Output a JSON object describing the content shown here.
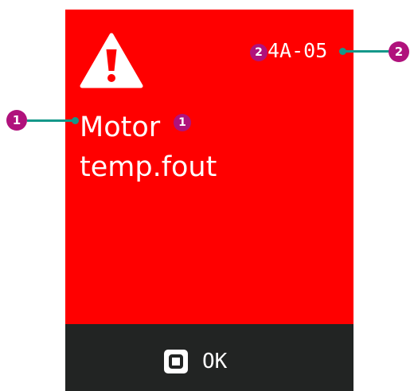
{
  "screen": {
    "background_color": "#ff0000",
    "footer_color": "#222423",
    "warning_icon": "warning-triangle-icon",
    "error_code": "4A-05",
    "message_lines": [
      "Motor",
      "temp.fout"
    ],
    "ok_button": {
      "icon": "square-button-icon",
      "label": "OK"
    }
  },
  "callouts": {
    "badge_color": "#b0127c",
    "leader_color": "#15988a",
    "items": [
      {
        "number": "1",
        "target": "error-message"
      },
      {
        "number": "2",
        "target": "error-code"
      }
    ]
  }
}
